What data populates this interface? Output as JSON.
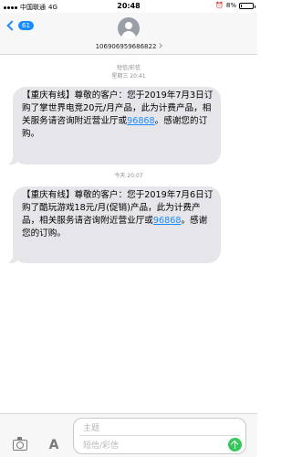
{
  "status": {
    "carrier": "中国联通",
    "network": "4G",
    "time": "20:48",
    "battery_text": "8%",
    "battery_level": 0.08
  },
  "header": {
    "back_count": "61",
    "sender": "106906959686822"
  },
  "meta1": {
    "label": "短信/彩信",
    "time": "星期三 20:41"
  },
  "messages": [
    {
      "text_before": "【重庆有线】尊敬的客户：您于2019年7月3日订购了掌世界电竞20元/月产品，此为计费产品，相关服务请咨询附近营业厅或",
      "link": "96868",
      "text_after": "。感谢您的订购。"
    },
    {
      "text_before": "【重庆有线】尊敬的客户：您于2019年7月6日订购了酷玩游戏18元/月(促销)产品，此为计费产品，相关服务请咨询附近营业厅或",
      "link": "96868",
      "text_after": "。感谢您的订购。"
    }
  ],
  "meta2": {
    "time": "今天 20:07"
  },
  "composer": {
    "subject_placeholder": "主题",
    "message_placeholder": "短信/彩信"
  },
  "icons": {
    "camera": "camera-icon",
    "appstore": "appstore-icon",
    "send": "send-arrow-icon",
    "back": "chevron-left-icon"
  }
}
